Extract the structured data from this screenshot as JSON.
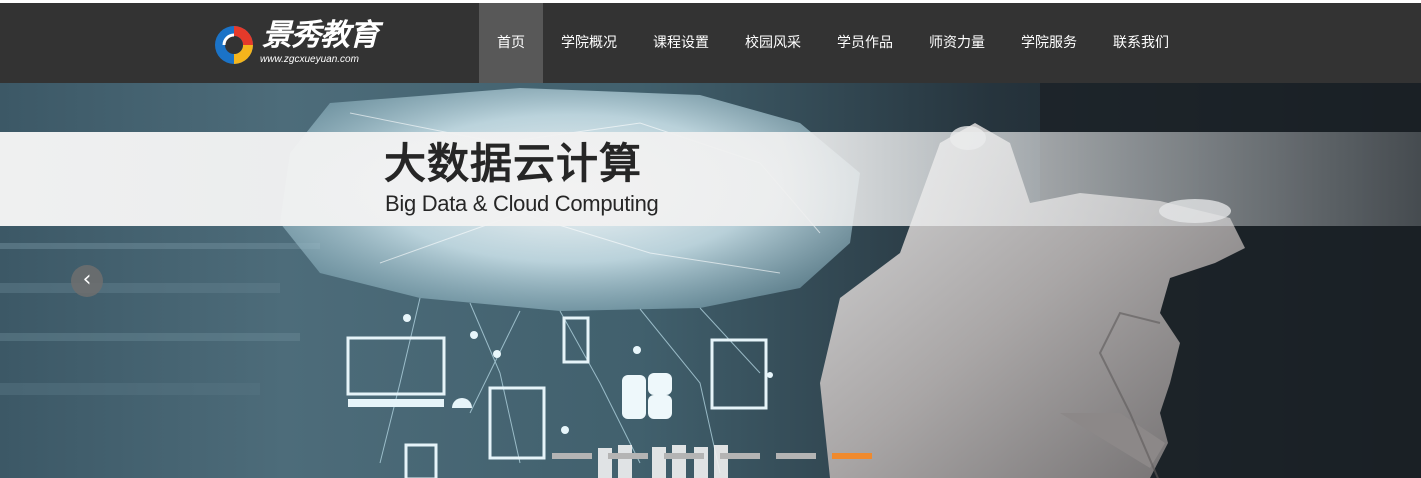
{
  "brand": {
    "title": "景秀教育",
    "url": "www.zgcxueyuan.com"
  },
  "nav": {
    "items": [
      {
        "label": "首页",
        "active": true
      },
      {
        "label": "学院概况",
        "active": false
      },
      {
        "label": "课程设置",
        "active": false
      },
      {
        "label": "校园风采",
        "active": false
      },
      {
        "label": "学员作品",
        "active": false
      },
      {
        "label": "师资力量",
        "active": false
      },
      {
        "label": "学院服务",
        "active": false
      },
      {
        "label": "联系我们",
        "active": false
      }
    ]
  },
  "banner": {
    "title": "大数据云计算",
    "subtitle": "Big Data & Cloud Computing",
    "prev_icon": "‹",
    "slide_count": 6,
    "active_slide": 6
  },
  "colors": {
    "navbar": "#333333",
    "nav_active": "#585858",
    "dot": "#b4b4b4",
    "dot_active": "#ef8a2e"
  }
}
